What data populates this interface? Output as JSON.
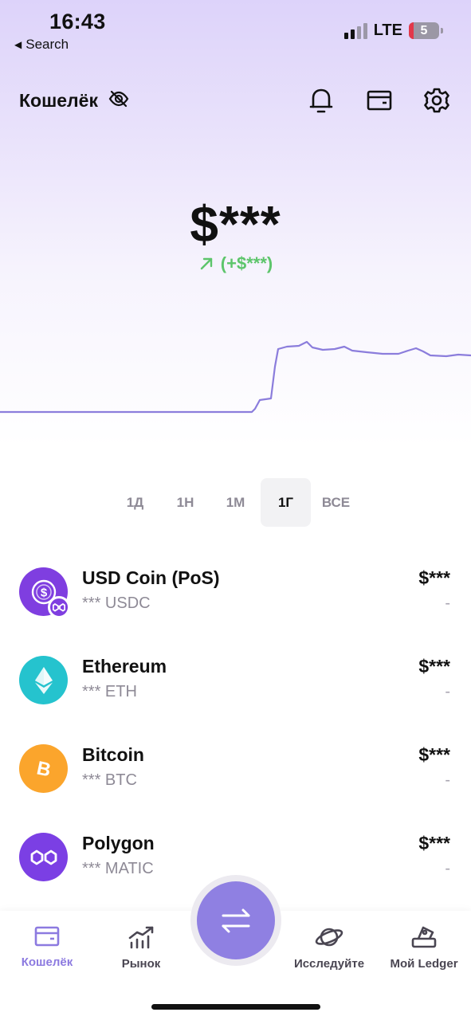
{
  "status_bar": {
    "time": "16:43",
    "back_label": "Search",
    "network": "LTE",
    "battery": "5"
  },
  "header": {
    "title": "Кошелёк"
  },
  "balance": {
    "amount": "$***",
    "change": "(+$***)"
  },
  "ranges": [
    {
      "label": "1Д",
      "active": false
    },
    {
      "label": "1Н",
      "active": false
    },
    {
      "label": "1М",
      "active": false
    },
    {
      "label": "1Г",
      "active": true
    },
    {
      "label": "ВСЕ",
      "active": false
    }
  ],
  "assets": [
    {
      "name": "USD Coin (PoS)",
      "amount": "*** USDC",
      "value": "$***",
      "change": "-",
      "icon": "usdc-icon",
      "color": "#7f3ee0"
    },
    {
      "name": "Ethereum",
      "amount": "*** ETH",
      "value": "$***",
      "change": "-",
      "icon": "ethereum-icon",
      "color": "#25c3ce"
    },
    {
      "name": "Bitcoin",
      "amount": "*** BTC",
      "value": "$***",
      "change": "-",
      "icon": "bitcoin-icon",
      "color": "#fba52c"
    },
    {
      "name": "Polygon",
      "amount": "*** MATIC",
      "value": "$***",
      "change": "-",
      "icon": "polygon-icon",
      "color": "#7b3fe4"
    }
  ],
  "nav": {
    "wallet": "Кошелёк",
    "market": "Рынок",
    "discover": "Исследуйте",
    "my_ledger": "Мой Ledger"
  },
  "colors": {
    "accent": "#8f80e2",
    "positive": "#5dc56b",
    "chart_line": "#8b7ddc"
  }
}
